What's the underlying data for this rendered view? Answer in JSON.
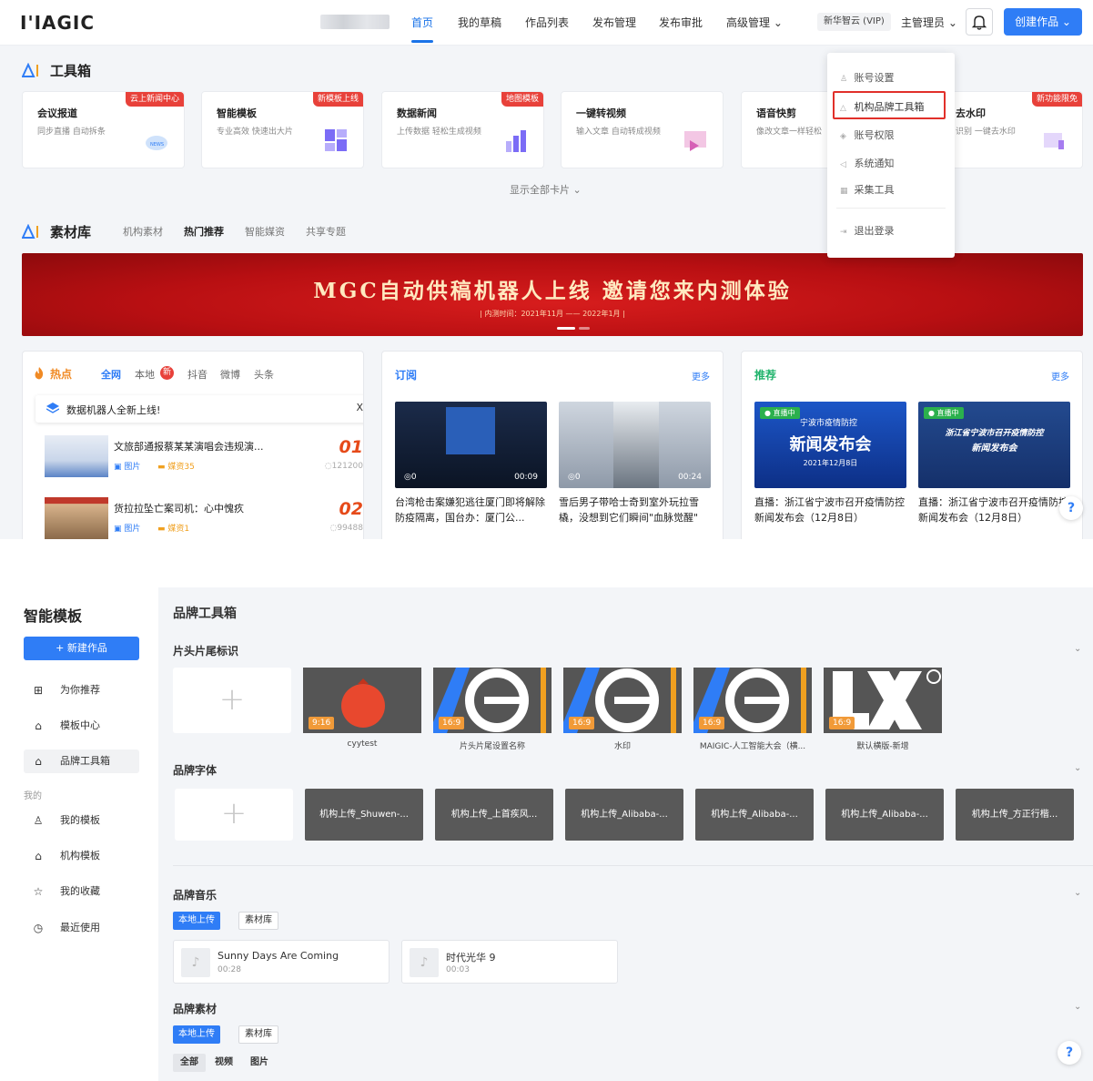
{
  "header": {
    "logo_text": "I'IAGIC",
    "nav": [
      "首页",
      "我的草稿",
      "作品列表",
      "发布管理",
      "发布审批",
      "高级管理 ⌄"
    ],
    "org": "新华智云 (VIP)",
    "user": "主管理员 ⌄",
    "create_label": "创建作品 ⌄"
  },
  "toolbox": {
    "title": "工具箱",
    "cards": [
      {
        "title": "会议报道",
        "desc": "同步直播 自动拆条",
        "tag": "云上新闻中心"
      },
      {
        "title": "智能模板",
        "desc": "专业高效 快速出大片",
        "tag": "新模板上线"
      },
      {
        "title": "数据新闻",
        "desc": "上传数据 轻松生成视频",
        "tag": "地图模板"
      },
      {
        "title": "一键转视频",
        "desc": "输入文章 自动转成视频",
        "tag": ""
      },
      {
        "title": "语音快剪",
        "desc": "像改文章一样轻松",
        "tag": ""
      },
      {
        "title": "去水印",
        "desc": "识别 一键去水印",
        "tag": "新功能限免"
      }
    ],
    "show_all": "显示全部卡片  ⌄"
  },
  "materials": {
    "title": "素材库",
    "tabs": [
      "机构素材",
      "热门推荐",
      "智能媒资",
      "共享专题"
    ]
  },
  "banner": {
    "title": "MGC自动供稿机器人上线  邀请您来内测体验",
    "subtitle": "| 内测时间：2021年11月 —— 2022年1月 |"
  },
  "hot": {
    "title": "热点",
    "tabs": [
      "全网",
      "本地",
      "抖音",
      "微博",
      "头条"
    ],
    "new_badge": "新",
    "notice": "数据机器人全新上线!",
    "notice_close": "X",
    "items": [
      {
        "title": "文旅部通报蔡某某演唱会违规演...",
        "type": "图片",
        "media": "媒资35",
        "rank": "01",
        "views": "121200"
      },
      {
        "title": "货拉拉坠亡案司机：心中愧疚",
        "type": "图片",
        "media": "媒资1",
        "rank": "02",
        "views": "99488"
      }
    ]
  },
  "subscribe": {
    "title": "订阅",
    "more": "更多",
    "videos": [
      {
        "views": "0",
        "duration": "00:09",
        "caption": "台湾枪击案嫌犯逃往厦门即将解除防疫隔离，国台办：厦门公..."
      },
      {
        "views": "0",
        "duration": "00:24",
        "caption": "雪后男子带哈士奇到室外玩拉雪橇，没想到它们瞬间\"血脉觉醒\""
      }
    ]
  },
  "recommend": {
    "title": "推荐",
    "more": "更多",
    "items": [
      {
        "badge": "● 直播中",
        "poster_line1": "宁波市疫情防控",
        "poster_line2": "新闻发布会",
        "poster_line3": "2021年12月8日",
        "caption": "直播：浙江省宁波市召开疫情防控新闻发布会（12月8日）"
      },
      {
        "badge": "● 直播中",
        "poster_line1": "浙江省宁波市召开疫情防控",
        "poster_line2": "新闻发布会",
        "poster_line3": "",
        "caption": "直播：浙江省宁波市召开疫情防控新闻发布会（12月8日）"
      }
    ]
  },
  "dropdown": {
    "items": [
      "账号设置",
      "机构品牌工具箱",
      "账号权限",
      "系统通知",
      "采集工具",
      "退出登录"
    ]
  },
  "help_label": "?",
  "sidebar": {
    "title": "智能模板",
    "new_label": "+ 新建作品",
    "items": [
      "为你推荐",
      "模板中心",
      "品牌工具箱"
    ],
    "group_label": "我的",
    "my_items": [
      "我的模板",
      "机构模板",
      "我的收藏",
      "最近使用"
    ]
  },
  "brand": {
    "title": "品牌工具箱",
    "intro": {
      "title": "片头片尾标识",
      "templates": [
        {
          "ratio": "9:16",
          "caption": "cyytest"
        },
        {
          "ratio": "16:9",
          "caption": "片头片尾设置名称"
        },
        {
          "ratio": "16:9",
          "caption": "水印"
        },
        {
          "ratio": "16:9",
          "caption": "MAIGIC-人工智能大会（横..."
        },
        {
          "ratio": "16:9",
          "caption": "默认横版-新增"
        }
      ]
    },
    "fonts": {
      "title": "品牌字体",
      "items": [
        "机构上传_Shuwen-...",
        "机构上传_上首疾风...",
        "机构上传_Alibaba-...",
        "机构上传_Alibaba-...",
        "机构上传_Alibaba-...",
        "机构上传_方正行楷..."
      ]
    },
    "music": {
      "title": "品牌音乐",
      "seg_on": "本地上传",
      "seg_off": "素材库",
      "items": [
        {
          "title": "Sunny Days Are Coming",
          "duration": "00:28"
        },
        {
          "title": "时代光华 9",
          "duration": "00:03"
        }
      ]
    },
    "assets": {
      "title": "品牌素材",
      "seg_on": "本地上传",
      "seg_off": "素材库",
      "filters": [
        "全部",
        "视频",
        "图片"
      ]
    }
  },
  "colors": {
    "accent": "#2f7df6",
    "tag_red": "#e8413a",
    "highlight": "#e1302a",
    "ratio_orange": "#f19a38"
  }
}
